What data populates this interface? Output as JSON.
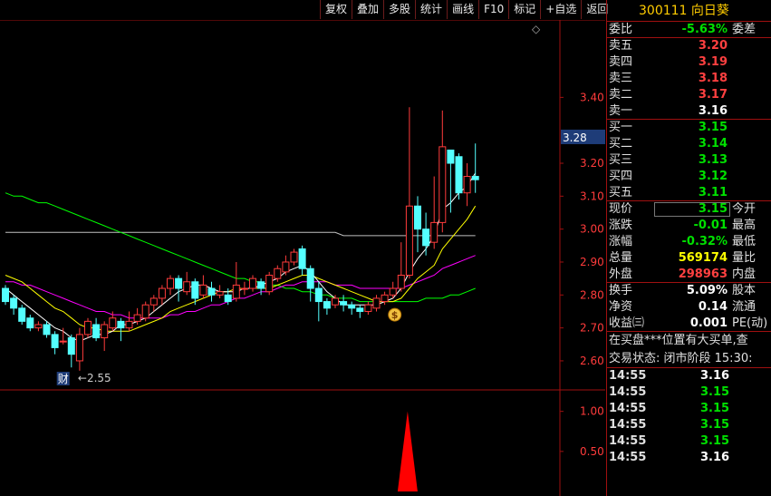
{
  "toolbar": [
    "复权",
    "叠加",
    "多股",
    "统计",
    "画线",
    "F10",
    "标记",
    "+自选",
    "返回"
  ],
  "stock": {
    "code": "300111",
    "name": "向日葵"
  },
  "weibi": {
    "label": "委比",
    "value": "-5.63%",
    "label2": "委差"
  },
  "asks": [
    {
      "label": "卖五",
      "price": "3.20"
    },
    {
      "label": "卖四",
      "price": "3.19"
    },
    {
      "label": "卖三",
      "price": "3.18"
    },
    {
      "label": "卖二",
      "price": "3.17"
    },
    {
      "label": "卖一",
      "price": "3.16"
    }
  ],
  "bids": [
    {
      "label": "买一",
      "price": "3.15"
    },
    {
      "label": "买二",
      "price": "3.14"
    },
    {
      "label": "买三",
      "price": "3.13"
    },
    {
      "label": "买四",
      "price": "3.12"
    },
    {
      "label": "买五",
      "price": "3.11"
    }
  ],
  "quote": [
    {
      "label": "现价",
      "value": "3.15",
      "label2": "今开",
      "color": "green"
    },
    {
      "label": "涨跌",
      "value": "-0.01",
      "label2": "最高",
      "color": "green"
    },
    {
      "label": "涨幅",
      "value": "-0.32%",
      "label2": "最低",
      "color": "green"
    },
    {
      "label": "总量",
      "value": "569174",
      "label2": "量比",
      "color": "yellow"
    },
    {
      "label": "外盘",
      "value": "298963",
      "label2": "内盘",
      "color": "red"
    }
  ],
  "stats": [
    {
      "label": "换手",
      "value": "5.09%",
      "label2": "股本"
    },
    {
      "label": "净资",
      "value": "0.14",
      "label2": "流通"
    },
    {
      "label": "收益㈢",
      "value": "0.001",
      "label2": "PE(动)"
    }
  ],
  "messages": [
    "在买盘***位置有大买单,查",
    "交易状态: 闭市阶段 15:30:"
  ],
  "trades": [
    {
      "time": "14:55",
      "price": "3.16",
      "color": "white"
    },
    {
      "time": "14:55",
      "price": "3.15",
      "color": "green"
    },
    {
      "time": "14:55",
      "price": "3.15",
      "color": "green"
    },
    {
      "time": "14:55",
      "price": "3.15",
      "color": "green"
    },
    {
      "time": "14:55",
      "price": "3.15",
      "color": "green"
    },
    {
      "time": "14:55",
      "price": "3.16",
      "color": "white"
    }
  ],
  "current_price_marker": "3.28",
  "low_marker": "←2.55",
  "finance_marker": "财",
  "diamond_marker": "◇",
  "coin_marker": "$",
  "colors": {
    "up": "#ff3b3b",
    "down": "#54ffff",
    "ma5": "#ffffff",
    "ma10": "#ffff00",
    "ma20": "#ff00ff",
    "ma60": "#00ff00",
    "ma_long": "#c0c0c0",
    "frame": "#a01010"
  },
  "chart_data": [
    {
      "type": "candlestick",
      "y_ticks": [
        2.6,
        2.7,
        2.8,
        2.9,
        3.0,
        3.1,
        3.2,
        3.3,
        3.4
      ],
      "y_tick_labels": [
        "2.60",
        "2.70",
        "2.80",
        "2.90",
        "3.00",
        "3.10",
        "3.20",
        "3.28",
        "3.40"
      ],
      "ylim": [
        2.52,
        3.58
      ],
      "candles": [
        [
          2.82,
          2.78,
          2.83,
          2.77
        ],
        [
          2.79,
          2.76,
          2.8,
          2.74
        ],
        [
          2.76,
          2.72,
          2.77,
          2.71
        ],
        [
          2.73,
          2.7,
          2.74,
          2.69
        ],
        [
          2.7,
          2.71,
          2.72,
          2.69
        ],
        [
          2.71,
          2.68,
          2.72,
          2.67
        ],
        [
          2.68,
          2.64,
          2.69,
          2.62
        ],
        [
          2.66,
          2.66,
          2.7,
          2.65
        ],
        [
          2.67,
          2.62,
          2.68,
          2.58
        ],
        [
          2.6,
          2.68,
          2.7,
          2.57
        ],
        [
          2.68,
          2.72,
          2.73,
          2.67
        ],
        [
          2.71,
          2.67,
          2.73,
          2.66
        ],
        [
          2.67,
          2.71,
          2.72,
          2.63
        ],
        [
          2.7,
          2.73,
          2.75,
          2.69
        ],
        [
          2.72,
          2.7,
          2.73,
          2.66
        ],
        [
          2.7,
          2.72,
          2.75,
          2.69
        ],
        [
          2.72,
          2.74,
          2.76,
          2.71
        ],
        [
          2.73,
          2.77,
          2.78,
          2.72
        ],
        [
          2.77,
          2.79,
          2.8,
          2.75
        ],
        [
          2.79,
          2.82,
          2.83,
          2.77
        ],
        [
          2.82,
          2.85,
          2.86,
          2.8
        ],
        [
          2.85,
          2.82,
          2.86,
          2.78
        ],
        [
          2.81,
          2.84,
          2.87,
          2.8
        ],
        [
          2.84,
          2.79,
          2.85,
          2.77
        ],
        [
          2.8,
          2.83,
          2.86,
          2.79
        ],
        [
          2.82,
          2.8,
          2.84,
          2.78
        ],
        [
          2.8,
          2.81,
          2.83,
          2.79
        ],
        [
          2.8,
          2.78,
          2.82,
          2.77
        ],
        [
          2.79,
          2.83,
          2.9,
          2.78
        ],
        [
          2.82,
          2.82,
          2.84,
          2.8
        ],
        [
          2.82,
          2.85,
          2.86,
          2.81
        ],
        [
          2.84,
          2.82,
          2.85,
          2.8
        ],
        [
          2.81,
          2.86,
          2.87,
          2.8
        ],
        [
          2.85,
          2.88,
          2.89,
          2.84
        ],
        [
          2.87,
          2.9,
          2.92,
          2.86
        ],
        [
          2.9,
          2.93,
          2.94,
          2.89
        ],
        [
          2.94,
          2.88,
          2.95,
          2.86
        ],
        [
          2.88,
          2.82,
          2.89,
          2.78
        ],
        [
          2.82,
          2.78,
          2.84,
          2.72
        ],
        [
          2.78,
          2.76,
          2.79,
          2.74
        ],
        [
          2.77,
          2.79,
          2.8,
          2.76
        ],
        [
          2.78,
          2.77,
          2.8,
          2.75
        ],
        [
          2.77,
          2.76,
          2.78,
          2.74
        ],
        [
          2.76,
          2.75,
          2.77,
          2.73
        ],
        [
          2.75,
          2.77,
          2.78,
          2.74
        ],
        [
          2.76,
          2.79,
          2.8,
          2.75
        ],
        [
          2.78,
          2.8,
          2.81,
          2.77
        ],
        [
          2.8,
          2.82,
          2.84,
          2.79
        ],
        [
          2.82,
          2.86,
          2.96,
          2.81
        ],
        [
          2.86,
          3.07,
          3.37,
          2.85
        ],
        [
          3.07,
          3.0,
          3.1,
          2.93
        ],
        [
          3.0,
          2.95,
          3.05,
          2.92
        ],
        [
          2.96,
          3.02,
          3.16,
          2.94
        ],
        [
          3.02,
          3.25,
          3.36,
          2.99
        ],
        [
          3.24,
          3.2,
          3.24,
          3.05
        ],
        [
          3.22,
          3.11,
          3.23,
          3.09
        ],
        [
          3.11,
          3.16,
          3.2,
          3.07
        ],
        [
          3.16,
          3.15,
          3.26,
          3.11
        ]
      ],
      "ma5": [
        2.82,
        2.8,
        2.78,
        2.76,
        2.74,
        2.72,
        2.7,
        2.69,
        2.67,
        2.66,
        2.67,
        2.68,
        2.68,
        2.69,
        2.71,
        2.71,
        2.72,
        2.73,
        2.75,
        2.77,
        2.79,
        2.81,
        2.82,
        2.83,
        2.83,
        2.82,
        2.81,
        2.81,
        2.81,
        2.82,
        2.82,
        2.83,
        2.84,
        2.85,
        2.87,
        2.88,
        2.89,
        2.87,
        2.84,
        2.81,
        2.79,
        2.77,
        2.77,
        2.77,
        2.77,
        2.77,
        2.78,
        2.79,
        2.82,
        2.87,
        2.91,
        2.94,
        2.98,
        3.06,
        3.08,
        3.11,
        3.13,
        3.17
      ],
      "ma10": [
        2.86,
        2.85,
        2.84,
        2.82,
        2.8,
        2.78,
        2.76,
        2.75,
        2.73,
        2.71,
        2.7,
        2.7,
        2.69,
        2.69,
        2.69,
        2.69,
        2.7,
        2.71,
        2.72,
        2.73,
        2.75,
        2.76,
        2.77,
        2.78,
        2.79,
        2.8,
        2.81,
        2.81,
        2.82,
        2.82,
        2.82,
        2.82,
        2.82,
        2.83,
        2.84,
        2.85,
        2.86,
        2.86,
        2.85,
        2.84,
        2.83,
        2.82,
        2.81,
        2.8,
        2.79,
        2.78,
        2.78,
        2.78,
        2.79,
        2.82,
        2.85,
        2.87,
        2.89,
        2.94,
        2.97,
        3.0,
        3.03,
        3.07
      ],
      "ma20": [
        2.84,
        2.84,
        2.83,
        2.83,
        2.82,
        2.81,
        2.8,
        2.79,
        2.78,
        2.77,
        2.76,
        2.75,
        2.75,
        2.74,
        2.74,
        2.73,
        2.73,
        2.73,
        2.73,
        2.73,
        2.74,
        2.74,
        2.75,
        2.75,
        2.76,
        2.77,
        2.77,
        2.78,
        2.79,
        2.79,
        2.8,
        2.81,
        2.81,
        2.82,
        2.83,
        2.83,
        2.84,
        2.84,
        2.84,
        2.84,
        2.83,
        2.83,
        2.83,
        2.82,
        2.82,
        2.82,
        2.82,
        2.82,
        2.82,
        2.83,
        2.84,
        2.85,
        2.86,
        2.88,
        2.89,
        2.9,
        2.91,
        2.92
      ],
      "ma60": [
        3.11,
        3.1,
        3.1,
        3.09,
        3.08,
        3.08,
        3.07,
        3.06,
        3.05,
        3.04,
        3.03,
        3.02,
        3.01,
        3.0,
        2.99,
        2.98,
        2.97,
        2.96,
        2.95,
        2.94,
        2.93,
        2.92,
        2.91,
        2.9,
        2.89,
        2.88,
        2.87,
        2.86,
        2.85,
        2.85,
        2.84,
        2.84,
        2.83,
        2.83,
        2.82,
        2.82,
        2.81,
        2.81,
        2.8,
        2.8,
        2.79,
        2.79,
        2.79,
        2.78,
        2.78,
        2.78,
        2.78,
        2.78,
        2.78,
        2.78,
        2.78,
        2.79,
        2.79,
        2.79,
        2.8,
        2.8,
        2.81,
        2.82
      ],
      "ma_long": [
        2.99,
        2.99,
        2.99,
        2.99,
        2.99,
        2.99,
        2.99,
        2.99,
        2.99,
        2.99,
        2.99,
        2.99,
        2.99,
        2.99,
        2.99,
        2.99,
        2.99,
        2.99,
        2.99,
        2.99,
        2.99,
        2.99,
        2.99,
        2.99,
        2.99,
        2.99,
        2.99,
        2.99,
        2.99,
        2.99,
        2.99,
        2.99,
        2.99,
        2.99,
        2.99,
        2.99,
        2.99,
        2.99,
        2.99,
        2.99,
        2.99,
        2.98,
        2.98,
        2.98,
        2.98,
        2.98,
        2.98,
        2.98,
        2.98,
        2.98,
        2.98,
        2.98,
        2.98,
        2.98,
        2.98,
        2.98,
        2.98,
        2.98
      ]
    },
    {
      "type": "area",
      "y_ticks": [
        0.5,
        1.0
      ],
      "y_tick_labels": [
        "0.50",
        "1.00"
      ],
      "ylim": [
        0,
        1.2
      ],
      "spike_index": 49,
      "values": [
        0,
        0,
        0,
        0,
        0,
        0,
        0,
        0,
        0,
        0,
        0,
        0,
        0,
        0,
        0,
        0,
        0,
        0,
        0,
        0,
        0,
        0,
        0,
        0,
        0,
        0,
        0,
        0,
        0,
        0,
        0,
        0,
        0,
        0,
        0,
        0,
        0,
        0,
        0,
        0,
        0,
        0,
        0,
        0,
        0,
        0,
        0,
        0,
        0,
        1.0,
        0,
        0,
        0,
        0,
        0,
        0,
        0,
        0
      ]
    }
  ]
}
